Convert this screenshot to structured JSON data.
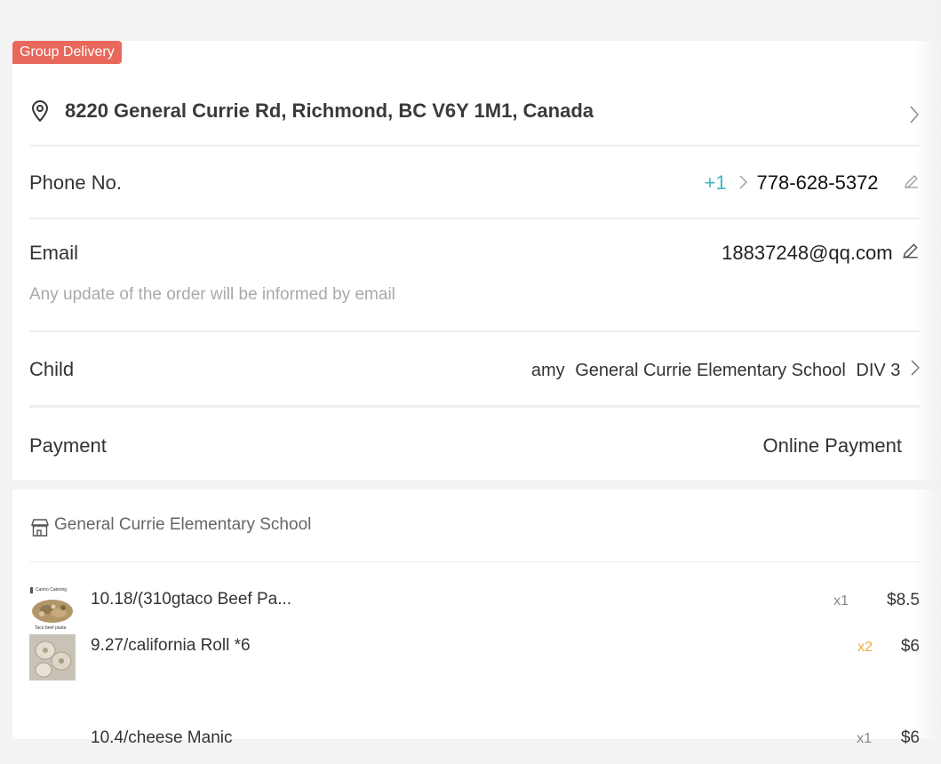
{
  "badge": "Group Delivery",
  "address": {
    "text": "8220 General Currie Rd, Richmond, BC V6Y 1M1, Canada"
  },
  "phone": {
    "label": "Phone No.",
    "country_code": "+1",
    "number": "778-628-5372"
  },
  "email": {
    "label": "Email",
    "value": "18837248@qq.com",
    "hint": "Any update of the order will be informed by email"
  },
  "child": {
    "label": "Child",
    "name": "amy",
    "school": "General Currie Elementary School",
    "division": "DIV 3"
  },
  "payment": {
    "label": "Payment",
    "value": "Online Payment"
  },
  "store": {
    "name": "General Currie Elementary School"
  },
  "items": [
    {
      "name": "10.18/(310gtaco Beef Pa...",
      "qty": "x1",
      "price": "$8.5",
      "thumb_caption_top": "Carino Catering",
      "thumb_caption_bottom": "Taco beef pasta"
    },
    {
      "name": "9.27/california Roll *6",
      "qty": "x2",
      "price": "$6"
    },
    {
      "name": "10.4/cheese Manic",
      "qty": "x1",
      "price": "$6"
    }
  ],
  "colors": {
    "badge_bg": "#e8685b",
    "country_code": "#3fb8c4",
    "qty_highlight": "#f2a843"
  }
}
